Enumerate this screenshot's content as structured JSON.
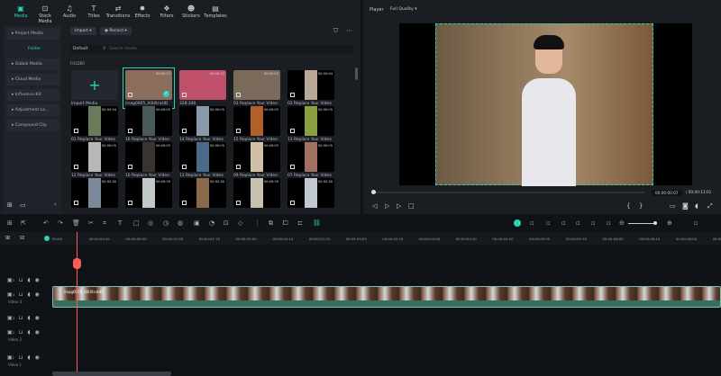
{
  "tabs": [
    {
      "label": "Media",
      "icon": "media-icon"
    },
    {
      "label": "Stock Media",
      "icon": "stock-icon"
    },
    {
      "label": "Audio",
      "icon": "music-icon"
    },
    {
      "label": "Titles",
      "icon": "titles-icon"
    },
    {
      "label": "Transitions",
      "icon": "transitions-icon"
    },
    {
      "label": "Effects",
      "icon": "effects-icon"
    },
    {
      "label": "Filters",
      "icon": "filters-icon"
    },
    {
      "label": "Stickers",
      "icon": "stickers-icon"
    },
    {
      "label": "Templates",
      "icon": "templates-icon"
    }
  ],
  "sidebar": {
    "items": [
      "Project Media",
      "Folder",
      "Global Media",
      "Cloud Media",
      "Influence Kit",
      "Adjustment La...",
      "Compound Clip"
    ]
  },
  "media": {
    "import_label": "Import",
    "record_label": "Record",
    "sort_label": "Default",
    "search_placeholder": "Search media",
    "folder_heading": "FOLDER",
    "import_media_label": "Import Media",
    "items": [
      {
        "label": "imag0005_AllUltraHD",
        "duration": "00:00:13",
        "color": "#8a6d5a",
        "selected": true
      },
      {
        "label": "328-240",
        "duration": "00:00:13",
        "color": "#c0506a"
      },
      {
        "label": "03 Replace Your Video",
        "duration": "00:00:05",
        "color": "#7a6a5a"
      },
      {
        "label": "02 Replace Your Video",
        "duration": "00:00:04",
        "color": "#b9a898"
      },
      {
        "label": "01 Replace Your Video",
        "duration": "00:00:34",
        "color": "#6a7a5a"
      },
      {
        "label": "16 Replace Your Video",
        "duration": "00:00:05",
        "color": "#4a5a58"
      },
      {
        "label": "14 Replace Your Video",
        "duration": "00:00:05",
        "color": "#8a9aaa"
      },
      {
        "label": "15 Replace Your Video",
        "duration": "00:00:05",
        "color": "#b0602a"
      },
      {
        "label": "13 Replace Your Video",
        "duration": "00:00:05",
        "color": "#8aa040"
      },
      {
        "label": "12 Replace Your Video",
        "duration": "00:00:05",
        "color": "#b8b8b8"
      },
      {
        "label": "10 Replace Your Video",
        "duration": "00:00:05",
        "color": "#3a3430"
      },
      {
        "label": "11 Replace Your Video",
        "duration": "00:00:05",
        "color": "#4a6a8a"
      },
      {
        "label": "09 Replace Your Video",
        "duration": "00:00:05",
        "color": "#d0c0a8"
      },
      {
        "label": "07 Replace Your Video",
        "duration": "00:00:05",
        "color": "#a07060"
      },
      {
        "label": "",
        "duration": "00:00:30",
        "color": "#7a8a9a"
      },
      {
        "label": "",
        "duration": "00:00:30",
        "color": "#c0c8c8"
      },
      {
        "label": "",
        "duration": "00:00:30",
        "color": "#8a6a4a"
      },
      {
        "label": "",
        "duration": "00:00:30",
        "color": "#c8c0b0"
      },
      {
        "label": "",
        "duration": "00:00:30",
        "color": "#c0c8d0"
      }
    ]
  },
  "player": {
    "label": "Player",
    "quality": "Full Quality",
    "current_time": "00:00:00:07",
    "total_time": "/ 00:00:13:01",
    "progress": 0.005
  },
  "timeline": {
    "ticks": [
      "00:00",
      "00:00:00:10",
      "00:00:00:20",
      "00:00:01:05",
      "00:00:01:15",
      "00:00:02:00",
      "00:00:02:10",
      "00:00:02:20",
      "00:00:03:05",
      "00:00:03:15",
      "00:00:04:00",
      "00:00:04:10",
      "00:00:04:20",
      "00:00:05:05",
      "00:00:05:15",
      "00:00:06:00",
      "00:00:06:10",
      "00:00:06:20",
      "00:00:07:05"
    ],
    "tracks": [
      {
        "num": "5",
        "label": ""
      },
      {
        "num": "4",
        "label": "Video 4"
      },
      {
        "num": "3",
        "label": ""
      },
      {
        "num": "2",
        "label": "Video 2"
      },
      {
        "num": "1",
        "label": "Video 1"
      }
    ],
    "clip_label": "imag0005_AllUltraHD",
    "accent": "#2fd1b2",
    "playhead_color": "#ff5a5a"
  }
}
